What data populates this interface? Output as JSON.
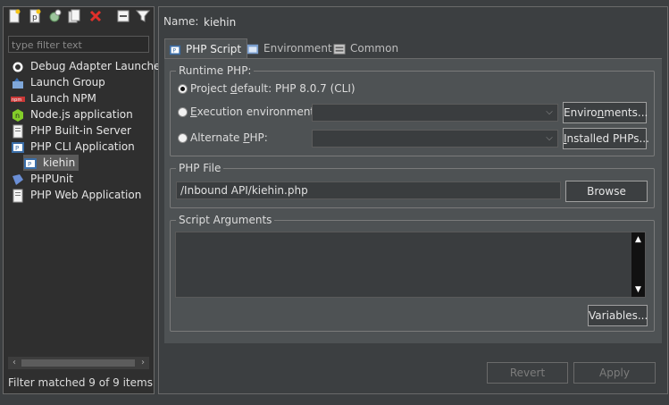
{
  "toolbar": {
    "icons": [
      "new-launch-config-icon",
      "new-prototype-icon",
      "export-icon",
      "duplicate-icon",
      "delete-icon",
      "collapse-all-icon",
      "filter-icon"
    ]
  },
  "filter": {
    "placeholder": "type filter text"
  },
  "tree": {
    "items": [
      {
        "label": "Debug Adapter Launcher",
        "icon": "debug-adapter-icon"
      },
      {
        "label": "Launch Group",
        "icon": "launch-group-icon"
      },
      {
        "label": "Launch NPM",
        "icon": "npm-icon"
      },
      {
        "label": "Node.js application",
        "icon": "nodejs-icon"
      },
      {
        "label": "PHP Built-in Server",
        "icon": "php-server-icon"
      },
      {
        "label": "PHP CLI Application",
        "icon": "php-cli-icon"
      },
      {
        "label": "kiehin",
        "icon": "php-file-icon"
      },
      {
        "label": "PHPUnit",
        "icon": "phpunit-icon"
      },
      {
        "label": "PHP Web Application",
        "icon": "php-web-icon"
      }
    ]
  },
  "filter_status": "Filter matched 9 of 9 items",
  "name": {
    "label": "Name:",
    "value": "kiehin"
  },
  "tabs": [
    {
      "label": "PHP Script",
      "icon": "php-script-icon",
      "active": true
    },
    {
      "label": "Environment",
      "icon": "environment-icon",
      "active": false
    },
    {
      "label": "Common",
      "icon": "common-icon",
      "active": false
    }
  ],
  "runtime": {
    "title": "Runtime PHP:",
    "project_default": {
      "pre": "Project ",
      "ul": "d",
      "post": "efault: PHP 8.0.7 (CLI)"
    },
    "execution_env": {
      "pre": "",
      "ul": "E",
      "post": "xecution environment:"
    },
    "alternate": {
      "pre": "Alternate ",
      "ul": "P",
      "post": "HP:"
    },
    "environments_button": {
      "pre": "Enviro",
      "ul": "n",
      "post": "ments..."
    },
    "installed_button": {
      "pre": "",
      "ul": "I",
      "post": "nstalled PHPs..."
    }
  },
  "php_file": {
    "title": "PHP File",
    "path": "/Inbound API/kiehin.php",
    "browse_label": "Browse"
  },
  "script_args": {
    "title": "Script Arguments",
    "value": "",
    "variables_label": "Variables..."
  },
  "footer": {
    "revert_label": "Revert",
    "apply_label": "Apply"
  }
}
